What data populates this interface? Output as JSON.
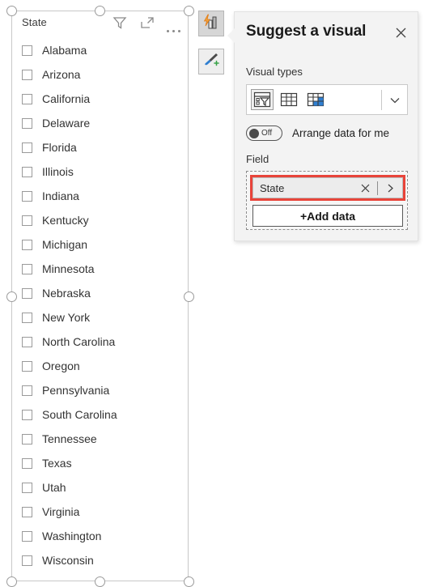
{
  "slicer": {
    "title": "State",
    "header_icons": [
      {
        "name": "filter-icon",
        "label": "Filter"
      },
      {
        "name": "focus-mode-icon",
        "label": "Focus mode"
      },
      {
        "name": "more-options-icon",
        "label": "More options"
      }
    ],
    "items": [
      {
        "label": "Alabama",
        "checked": false
      },
      {
        "label": "Arizona",
        "checked": false
      },
      {
        "label": "California",
        "checked": false
      },
      {
        "label": "Delaware",
        "checked": false
      },
      {
        "label": "Florida",
        "checked": false
      },
      {
        "label": "Illinois",
        "checked": false
      },
      {
        "label": "Indiana",
        "checked": false
      },
      {
        "label": "Kentucky",
        "checked": false
      },
      {
        "label": "Michigan",
        "checked": false
      },
      {
        "label": "Minnesota",
        "checked": false
      },
      {
        "label": "Nebraska",
        "checked": false
      },
      {
        "label": "New York",
        "checked": false
      },
      {
        "label": "North Carolina",
        "checked": false
      },
      {
        "label": "Oregon",
        "checked": false
      },
      {
        "label": "Pennsylvania",
        "checked": false
      },
      {
        "label": "South Carolina",
        "checked": false
      },
      {
        "label": "Tennessee",
        "checked": false
      },
      {
        "label": "Texas",
        "checked": false
      },
      {
        "label": "Utah",
        "checked": false
      },
      {
        "label": "Virginia",
        "checked": false
      },
      {
        "label": "Washington",
        "checked": false
      },
      {
        "label": "Wisconsin",
        "checked": false
      }
    ]
  },
  "floating_buttons": [
    {
      "name": "suggest-visual-button",
      "icon": "suggest-visual-icon",
      "active": true
    },
    {
      "name": "format-visual-button",
      "icon": "paintbrush-add-icon",
      "active": false
    }
  ],
  "panel": {
    "title": "Suggest a visual",
    "close_label": "✕",
    "visual_types_label": "Visual types",
    "visual_types": [
      {
        "name": "slicer-visual-type-icon",
        "selected": true
      },
      {
        "name": "table-visual-type-icon",
        "selected": false
      },
      {
        "name": "matrix-visual-type-icon",
        "selected": false
      }
    ],
    "visual_types_chevron": "chevron-down-icon",
    "arrange": {
      "state": "Off",
      "label": "Arrange data for me",
      "on": false
    },
    "field_label": "Field",
    "field_pill": {
      "name": "State",
      "remove_label": "✕",
      "expand_label": "›",
      "highlight_color": "#e8443a"
    },
    "add_data_label": "+Add data"
  },
  "colors": {
    "panel_background": "#f3f3f3",
    "highlight": "#e8443a",
    "matrix_accent": "#2f7fd1",
    "toolbar_icon": "#8a8a8a"
  }
}
